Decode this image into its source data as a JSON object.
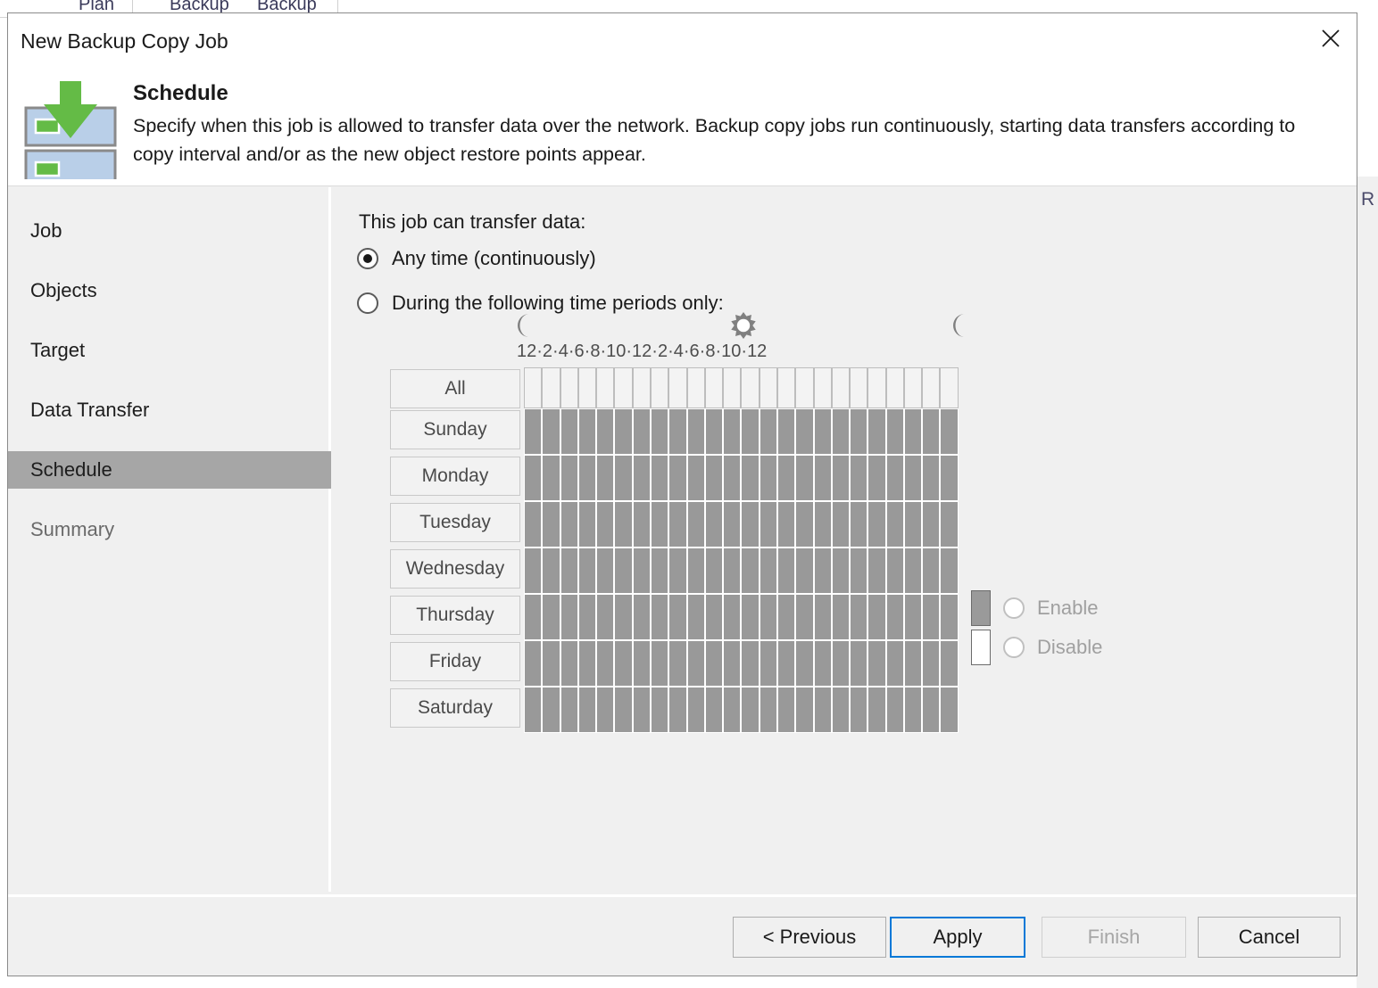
{
  "background": {
    "ribbon_items": [
      "Plan",
      "Backup",
      "Backup"
    ],
    "right_edge_letter": "R"
  },
  "dialog": {
    "title": "New Backup Copy Job",
    "close_icon": "close-icon",
    "header": {
      "icon": "backup-copy-job-icon",
      "title": "Schedule",
      "description": "Specify when this job is allowed to transfer data over the network. Backup copy jobs run continuously, starting data transfers according to copy interval and/or as the new object restore points appear."
    }
  },
  "sidebar": {
    "items": [
      {
        "label": "Job",
        "selected": false
      },
      {
        "label": "Objects",
        "selected": false
      },
      {
        "label": "Target",
        "selected": false
      },
      {
        "label": "Data Transfer",
        "selected": false
      },
      {
        "label": "Schedule",
        "selected": true
      },
      {
        "label": "Summary",
        "selected": false
      }
    ]
  },
  "main": {
    "question_label": "This job can transfer data:",
    "options": [
      {
        "label": "Any time (continuously)",
        "checked": true
      },
      {
        "label": "During the following time periods only:",
        "checked": false
      }
    ],
    "schedule": {
      "enabled": false,
      "night_icon_left": "moon-icon",
      "day_icon": "sun-icon",
      "night_icon_right": "moon-icon",
      "hour_labels": [
        "12",
        "2",
        "4",
        "6",
        "8",
        "10",
        "12",
        "2",
        "4",
        "6",
        "8",
        "10",
        "12"
      ],
      "hour_separator": "·",
      "all_row_label": "All",
      "days": [
        "Sunday",
        "Monday",
        "Tuesday",
        "Wednesday",
        "Thursday",
        "Friday",
        "Saturday"
      ],
      "hours_per_day": 24,
      "all_row_cells": [
        0,
        0,
        0,
        0,
        0,
        0,
        0,
        0,
        0,
        0,
        0,
        0,
        0,
        0,
        0,
        0,
        0,
        0,
        0,
        0,
        0,
        0,
        0,
        0
      ],
      "day_cells": [
        [
          1,
          1,
          1,
          1,
          1,
          1,
          1,
          1,
          1,
          1,
          1,
          1,
          1,
          1,
          1,
          1,
          1,
          1,
          1,
          1,
          1,
          1,
          1,
          1
        ],
        [
          1,
          1,
          1,
          1,
          1,
          1,
          1,
          1,
          1,
          1,
          1,
          1,
          1,
          1,
          1,
          1,
          1,
          1,
          1,
          1,
          1,
          1,
          1,
          1
        ],
        [
          1,
          1,
          1,
          1,
          1,
          1,
          1,
          1,
          1,
          1,
          1,
          1,
          1,
          1,
          1,
          1,
          1,
          1,
          1,
          1,
          1,
          1,
          1,
          1
        ],
        [
          1,
          1,
          1,
          1,
          1,
          1,
          1,
          1,
          1,
          1,
          1,
          1,
          1,
          1,
          1,
          1,
          1,
          1,
          1,
          1,
          1,
          1,
          1,
          1
        ],
        [
          1,
          1,
          1,
          1,
          1,
          1,
          1,
          1,
          1,
          1,
          1,
          1,
          1,
          1,
          1,
          1,
          1,
          1,
          1,
          1,
          1,
          1,
          1,
          1
        ],
        [
          1,
          1,
          1,
          1,
          1,
          1,
          1,
          1,
          1,
          1,
          1,
          1,
          1,
          1,
          1,
          1,
          1,
          1,
          1,
          1,
          1,
          1,
          1,
          1
        ],
        [
          1,
          1,
          1,
          1,
          1,
          1,
          1,
          1,
          1,
          1,
          1,
          1,
          1,
          1,
          1,
          1,
          1,
          1,
          1,
          1,
          1,
          1,
          1,
          1
        ]
      ],
      "legend": [
        {
          "label": "Enable",
          "state": "on",
          "checked": false
        },
        {
          "label": "Disable",
          "state": "off",
          "checked": false
        }
      ]
    }
  },
  "footer": {
    "buttons": [
      {
        "label": "< Previous",
        "state": "normal"
      },
      {
        "label": "Apply",
        "state": "focused"
      },
      {
        "label": "Finish",
        "state": "disabled"
      },
      {
        "label": "Cancel",
        "state": "normal"
      }
    ]
  },
  "colors": {
    "accent": "#0078d7",
    "selected_sidebar": "#a6a6a6",
    "cell_enabled": "#999999",
    "cell_disabled": "#f3f3f3",
    "icon_green": "#6cb council",
    "dialog_bg": "#f0f0f0"
  }
}
